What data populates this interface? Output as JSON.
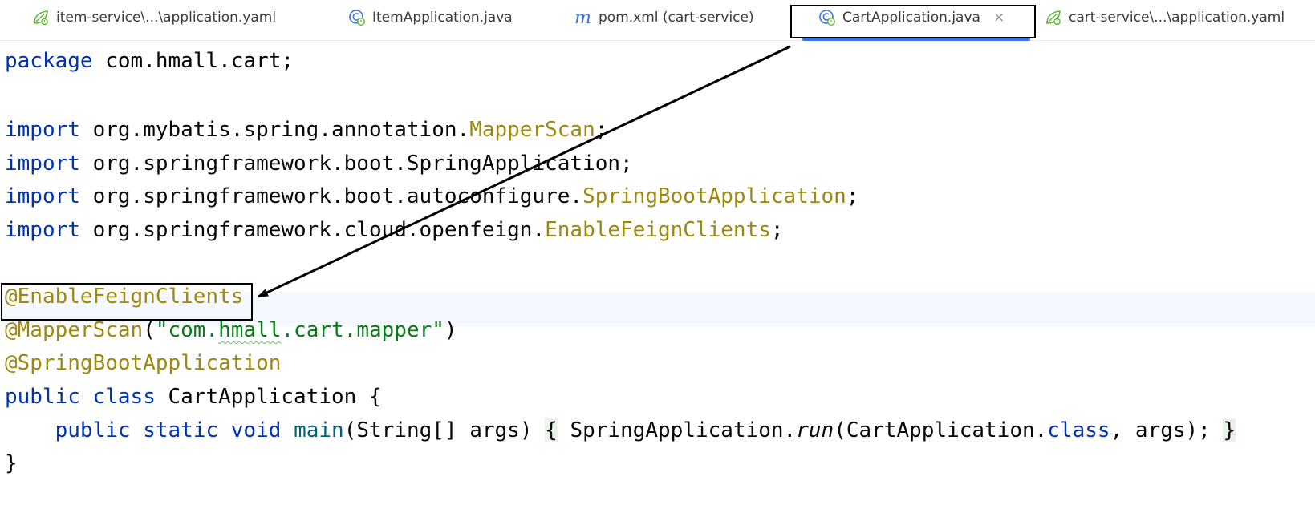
{
  "tabs": [
    {
      "label": "item-service\\...\\application.yaml",
      "icon": "spring-yaml-icon",
      "active": false
    },
    {
      "label": "ItemApplication.java",
      "icon": "spring-boot-class-icon",
      "active": false
    },
    {
      "label": "pom.xml (cart-service)",
      "icon": "maven-icon",
      "icon_glyph": "m",
      "active": false
    },
    {
      "label": "CartApplication.java",
      "icon": "spring-boot-class-icon",
      "active": true,
      "close": "×"
    },
    {
      "label": "cart-service\\...\\application.yaml",
      "icon": "spring-yaml-icon",
      "active": false
    }
  ],
  "code": {
    "package_kw": "package",
    "package_name": " com.hmall.cart;",
    "import_kw": "import",
    "import1_path": " org.mybatis.spring.annotation.",
    "import1_class": "MapperScan",
    "import1_end": ";",
    "import2_path": " org.springframework.boot.SpringApplication;",
    "import3_path": " org.springframework.boot.autoconfigure.",
    "import3_class": "SpringBootApplication",
    "import3_end": ";",
    "import4_path": " org.springframework.cloud.openfeign.",
    "import4_class": "EnableFeignClients",
    "import4_end": ";",
    "ann1": "@EnableFeignClients",
    "ann2": "@MapperScan",
    "ann2_open": "(",
    "ann2_str_a": "\"com.",
    "ann2_str_typo": "hmall",
    "ann2_str_b": ".cart.mapper\"",
    "ann2_close": ")",
    "ann3": "@SpringBootApplication",
    "class_kw1": "public",
    "class_kw2": "class",
    "class_name": " CartApplication {",
    "indent": "    ",
    "main_kw1": "public",
    "main_kw2": "static",
    "main_kw3": "void",
    "main_name": "main",
    "main_params": "(String[] args) ",
    "brace_open": "{",
    "run_prefix": " SpringApplication.",
    "run_method": "run",
    "run_arg_a": "(CartApplication.",
    "run_arg_kw": "class",
    "run_arg_b": ", args); ",
    "brace_close": "}",
    "class_close": "}"
  },
  "colors": {
    "keyword": "#0033b3",
    "annotation": "#9e880d",
    "string": "#067d17",
    "text": "#080808",
    "tab_underline": "#3574f0",
    "spring_icon": "#5fb832",
    "class_icon": "#3d6fd9"
  }
}
